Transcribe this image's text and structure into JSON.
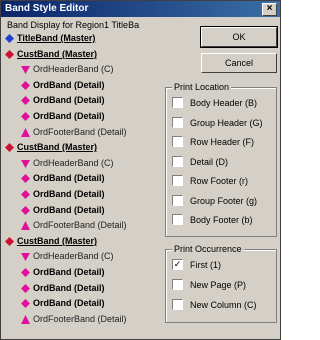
{
  "window": {
    "title": "Band Style Editor",
    "close_glyph": "×"
  },
  "band_caption": "Band Display for Region1 TitleBa",
  "tree": [
    {
      "label": "TitleBand (Master)",
      "type": "master-blue"
    },
    {
      "label": "CustBand (Master)",
      "type": "master-red"
    },
    {
      "label": "OrdHeaderBand (C)",
      "type": "header"
    },
    {
      "label": "OrdBand (Detail)",
      "type": "detail"
    },
    {
      "label": "OrdBand (Detail)",
      "type": "detail"
    },
    {
      "label": "OrdBand (Detail)",
      "type": "detail"
    },
    {
      "label": "OrdFooterBand (Detail)",
      "type": "footer"
    },
    {
      "label": "CustBand (Master)",
      "type": "master-red"
    },
    {
      "label": "OrdHeaderBand (C)",
      "type": "header"
    },
    {
      "label": "OrdBand (Detail)",
      "type": "detail"
    },
    {
      "label": "OrdBand (Detail)",
      "type": "detail"
    },
    {
      "label": "OrdBand (Detail)",
      "type": "detail"
    },
    {
      "label": "OrdFooterBand (Detail)",
      "type": "footer"
    },
    {
      "label": "CustBand (Master)",
      "type": "master-red"
    },
    {
      "label": "OrdHeaderBand (C)",
      "type": "header"
    },
    {
      "label": "OrdBand (Detail)",
      "type": "detail"
    },
    {
      "label": "OrdBand (Detail)",
      "type": "detail"
    },
    {
      "label": "OrdBand (Detail)",
      "type": "detail"
    },
    {
      "label": "OrdFooterBand (Detail)",
      "type": "footer"
    }
  ],
  "buttons": {
    "ok": "OK",
    "cancel": "Cancel"
  },
  "print_location": {
    "title": "Print Location",
    "items": [
      {
        "label": "Body Header (B)",
        "checked": false
      },
      {
        "label": "Group Header (G)",
        "checked": false
      },
      {
        "label": "Row Header (F)",
        "checked": false
      },
      {
        "label": "Detail (D)",
        "checked": false
      },
      {
        "label": "Row Footer (r)",
        "checked": false
      },
      {
        "label": "Group Footer (g)",
        "checked": false
      },
      {
        "label": "Body Footer (b)",
        "checked": false
      }
    ]
  },
  "print_occurrence": {
    "title": "Print Occurrence",
    "items": [
      {
        "label": "First (1)",
        "checked": true
      },
      {
        "label": "New Page (P)",
        "checked": false
      },
      {
        "label": "New Column (C)",
        "checked": false
      }
    ]
  },
  "colors": {
    "title_bar": "#0a246a",
    "master_blue": "#1f3fd0",
    "master_red": "#cc1133",
    "detail_magenta": "#e0109a"
  }
}
